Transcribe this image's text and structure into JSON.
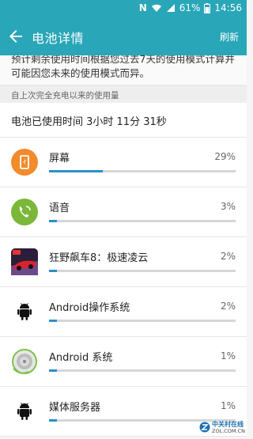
{
  "status_bar": {
    "left_text": "⊙",
    "n_icon": "N",
    "battery_percent": "61%",
    "time": "14:56",
    "icons": [
      "n-icon",
      "wifi-icon",
      "signal-icon",
      "battery-icon"
    ]
  },
  "app_bar": {
    "back_icon": "arrow-left-icon",
    "title": "电池详情",
    "action": "刷新"
  },
  "description": "预计剩余使用时间根据您过去7天的使用模式计算并可能因您未来的使用模式而异。",
  "section_header": "自上次完全充电以来的使用量",
  "total_usage": "电池已使用时间 3小时 11分 31秒",
  "colors": {
    "accent": "#29a6b8",
    "progress": "#2a90c8",
    "screen_icon": "#f28b2c",
    "voice_icon": "#7bb83a"
  },
  "items": [
    {
      "name": "屏幕",
      "percent": "29%",
      "value": 0.29,
      "icon": "screen-icon"
    },
    {
      "name": "语音",
      "percent": "3%",
      "value": 0.03,
      "icon": "phone-icon"
    },
    {
      "name": "狂野飙车8：极速凌云",
      "percent": "2%",
      "value": 0.02,
      "icon": "car-game-icon"
    },
    {
      "name": "Android操作系统",
      "percent": "2%",
      "value": 0.02,
      "icon": "android-icon"
    },
    {
      "name": "Android 系统",
      "percent": "1%",
      "value": 0.01,
      "icon": "android-system-icon"
    },
    {
      "name": "媒体服务器",
      "percent": "1%",
      "value": 0.01,
      "icon": "android-icon"
    }
  ],
  "watermark": {
    "cn": "中关村在线",
    "en": "ZOL.COM.CN"
  }
}
